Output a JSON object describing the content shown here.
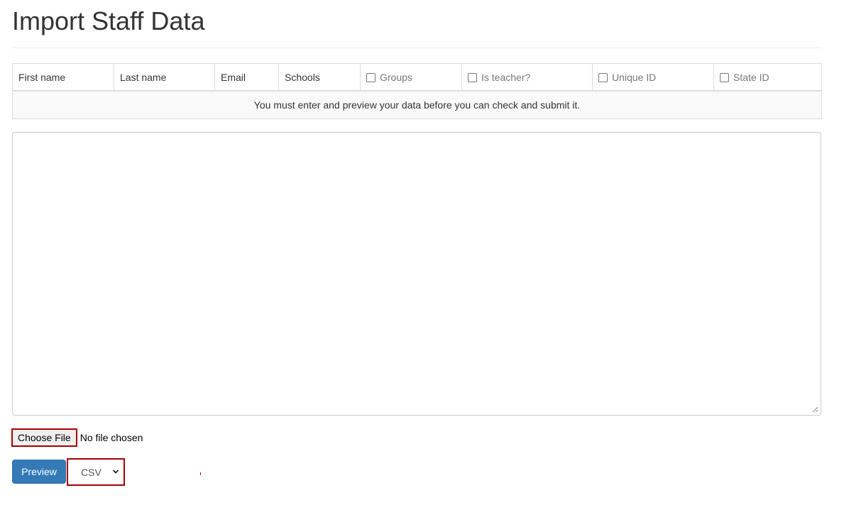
{
  "page": {
    "title": "Import Staff Data"
  },
  "columns": [
    {
      "label": "First name",
      "optional": false
    },
    {
      "label": "Last name",
      "optional": false
    },
    {
      "label": "Email",
      "optional": false
    },
    {
      "label": "Schools",
      "optional": false
    },
    {
      "label": "Groups",
      "optional": true,
      "checked": false
    },
    {
      "label": "Is teacher?",
      "optional": true,
      "checked": false
    },
    {
      "label": "Unique ID",
      "optional": true,
      "checked": false
    },
    {
      "label": "State ID",
      "optional": true,
      "checked": false
    }
  ],
  "notice": "You must enter and preview your data before you can check and submit it.",
  "data_input": {
    "value": ""
  },
  "file_input": {
    "button_label": "Choose File",
    "status": "No file chosen"
  },
  "actions": {
    "preview_label": "Preview",
    "format_selected": "CSV"
  },
  "colors": {
    "primary": "#337ab7",
    "highlight_border": "#a50000",
    "table_border": "#dddddd",
    "notice_background": "#f9f9f9"
  },
  "icons": {
    "format_dropdown": "chevron-down-icon",
    "textarea_resize": "resize-handle-icon"
  }
}
